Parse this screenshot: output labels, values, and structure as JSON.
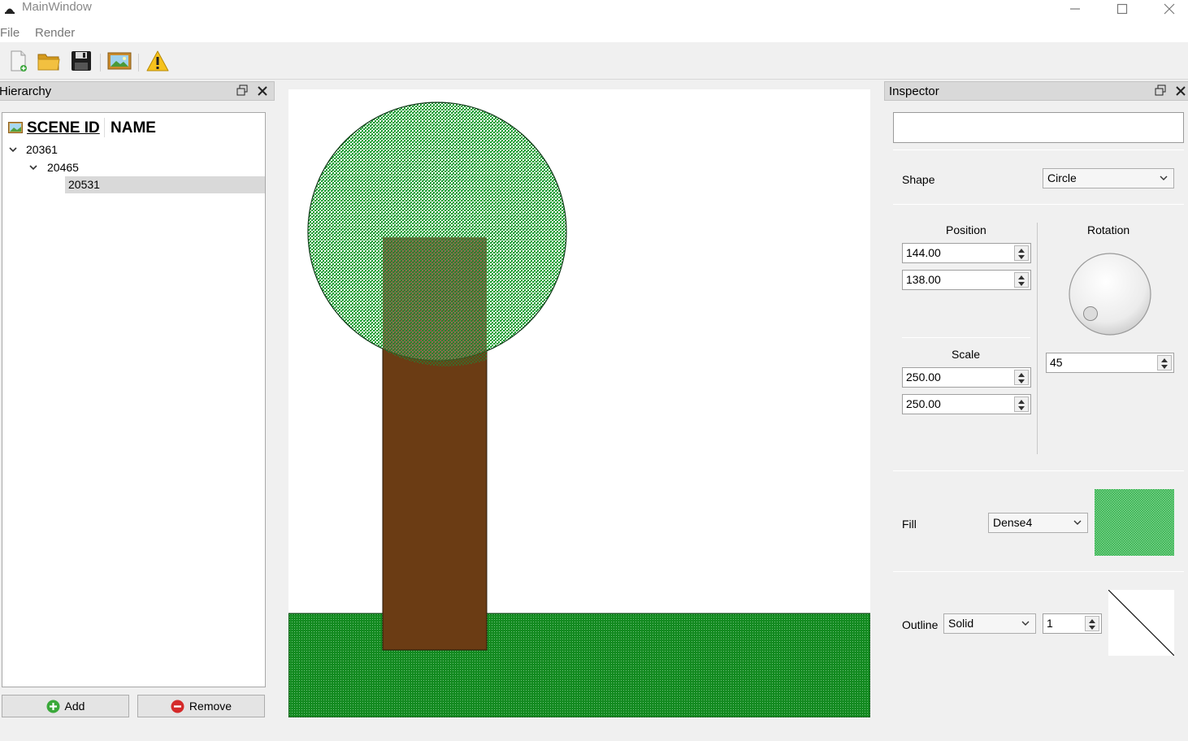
{
  "window": {
    "title": "MainWindow"
  },
  "menu": {
    "items": [
      "File",
      "Render"
    ]
  },
  "toolbar": {
    "buttons": [
      "new-file-icon",
      "open-folder-icon",
      "save-icon",
      "render-image-icon",
      "warning-icon"
    ]
  },
  "hierarchy": {
    "title": "Hierarchy",
    "columns": [
      "SCENE ID",
      "NAME"
    ],
    "rows": [
      {
        "id": "20361",
        "expanded": true,
        "depth": 0
      },
      {
        "id": "20465",
        "expanded": true,
        "depth": 1
      },
      {
        "id": "20531",
        "selected": true,
        "depth": 2
      }
    ],
    "add_label": "Add",
    "remove_label": "Remove"
  },
  "inspector": {
    "title": "Inspector",
    "name_value": "",
    "shape_label": "Shape",
    "shape_value": "Circle",
    "position_label": "Position",
    "position_x": "144.00",
    "position_y": "138.00",
    "rotation_label": "Rotation",
    "rotation_value": "45",
    "scale_label": "Scale",
    "scale_x": "250.00",
    "scale_y": "250.00",
    "fill_label": "Fill",
    "fill_pattern": "Dense4",
    "fill_color": "#2fae4a",
    "outline_label": "Outline",
    "outline_style": "Solid",
    "outline_width": "1"
  },
  "colors": {
    "tree_foliage": "#28a83a",
    "trunk": "#6b3c14",
    "ground": "#138a20",
    "selection": "#d9d9d9"
  }
}
